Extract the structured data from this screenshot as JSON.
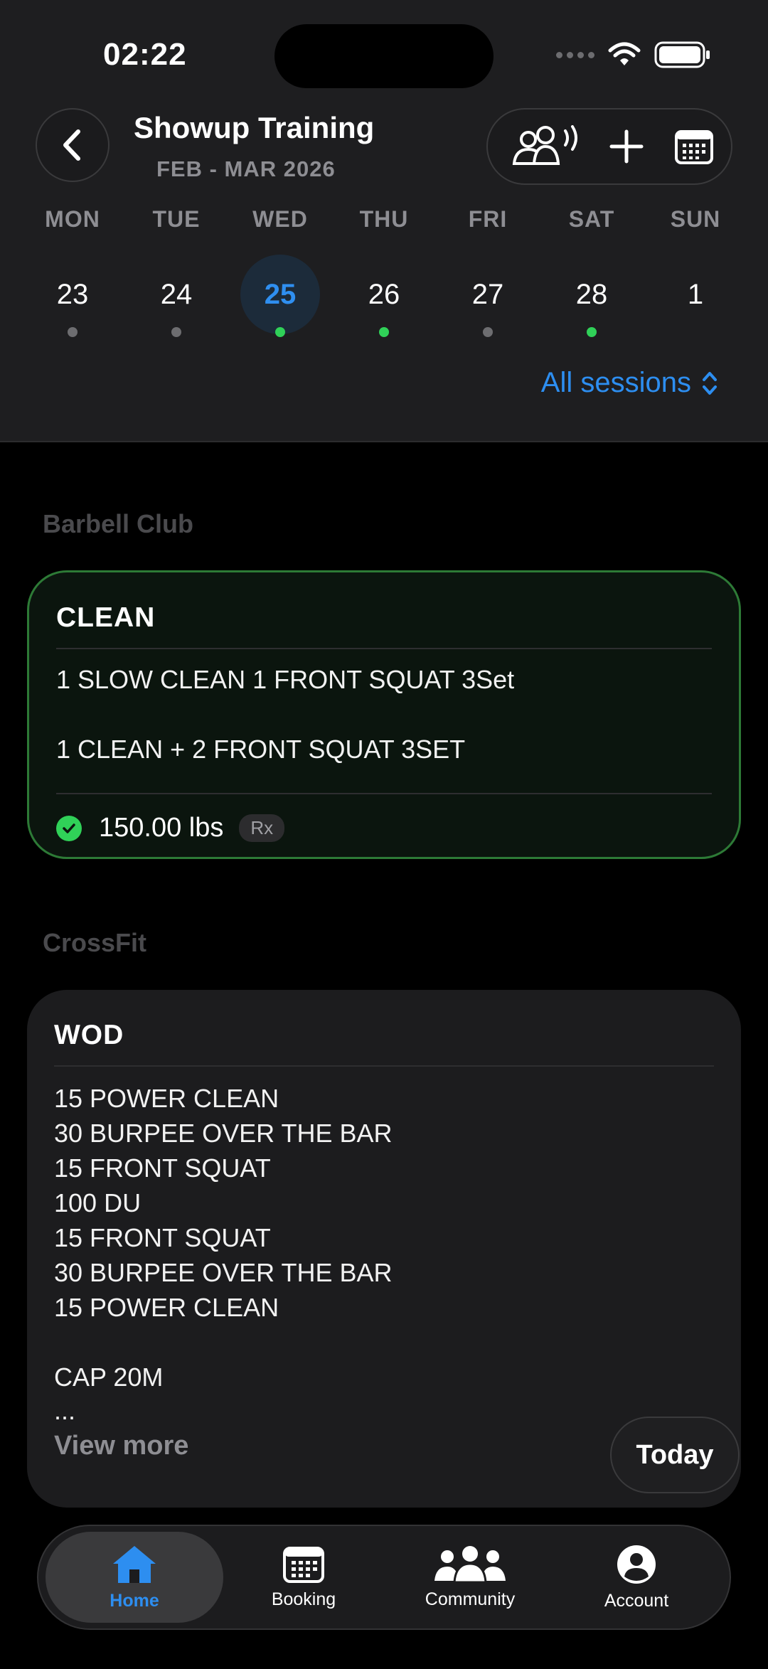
{
  "status_bar": {
    "time": "02:22"
  },
  "header": {
    "title": "Showup Training",
    "subtitle": "FEB - MAR 2026",
    "sessions_filter": "All sessions"
  },
  "week": [
    {
      "day": "MON",
      "date": "23",
      "dot": "#6d6d70",
      "selected": false
    },
    {
      "day": "TUE",
      "date": "24",
      "dot": "#6d6d70",
      "selected": false
    },
    {
      "day": "WED",
      "date": "25",
      "dot": "#30d158",
      "selected": true
    },
    {
      "day": "THU",
      "date": "26",
      "dot": "#30d158",
      "selected": false
    },
    {
      "day": "FRI",
      "date": "27",
      "dot": "#6d6d70",
      "selected": false
    },
    {
      "day": "SAT",
      "date": "28",
      "dot": "#30d158",
      "selected": false
    },
    {
      "day": "SUN",
      "date": "1",
      "dot": "",
      "selected": false
    }
  ],
  "barbell": {
    "section": "Barbell Club",
    "title": "CLEAN",
    "line1": "1 SLOW CLEAN 1 FRONT SQUAT 3Set",
    "line2": "1 CLEAN + 2 FRONT SQUAT 3SET",
    "result": "150.00 lbs",
    "badge": "Rx"
  },
  "crossfit": {
    "section": "CrossFit",
    "title": "WOD",
    "lines": [
      "15 POWER CLEAN",
      "30 BURPEE OVER THE BAR",
      "15 FRONT SQUAT",
      "100 DU",
      "15 FRONT SQUAT",
      "30 BURPEE OVER THE BAR",
      "15 POWER CLEAN",
      "",
      "CAP 20M",
      "..."
    ],
    "view_more": "View more"
  },
  "today_button": "Today",
  "tabs": [
    {
      "label": "Home",
      "icon": "home-icon",
      "active": true
    },
    {
      "label": "Booking",
      "icon": "calendar-icon",
      "active": false
    },
    {
      "label": "Community",
      "icon": "community-icon",
      "active": false
    },
    {
      "label": "Account",
      "icon": "account-icon",
      "active": false
    }
  ],
  "colors": {
    "accent": "#2d8ef0",
    "success": "#30d158",
    "card_border": "#2d7a36"
  }
}
